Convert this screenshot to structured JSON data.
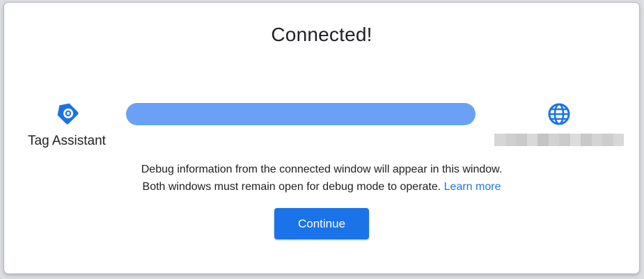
{
  "dialog": {
    "title": "Connected!",
    "left_endpoint": {
      "icon": "tag-assistant-icon",
      "label": "Tag Assistant"
    },
    "connection": {
      "status": "connected",
      "progress": 1.0
    },
    "right_endpoint": {
      "icon": "globe-icon",
      "label_redacted": true
    },
    "message": {
      "line1": "Debug information from the connected window will appear in this window.",
      "line2": "Both windows must remain open for debug mode to operate.",
      "link": "Learn more"
    },
    "continue_label": "Continue"
  },
  "colors": {
    "accent": "#1a73e8",
    "bar": "#6aa1f7",
    "text": "#202124"
  }
}
